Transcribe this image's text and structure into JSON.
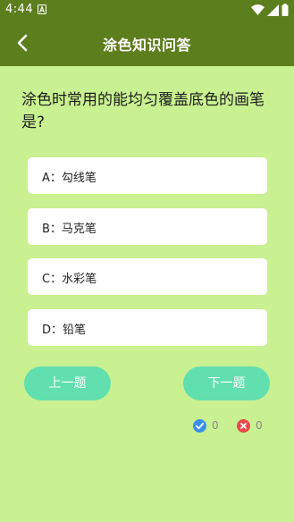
{
  "status_bar": {
    "time": "4:44",
    "notification_icon": "a-notification-icon",
    "wifi_icon": "wifi-icon",
    "signal_icon": "signal-icon",
    "battery_icon": "battery-icon"
  },
  "app_bar": {
    "back_icon": "chevron-left-icon",
    "title": "涂色知识问答"
  },
  "quiz": {
    "question": "涂色时常用的能均匀覆盖底色的画笔是?",
    "options": [
      {
        "text": "A：勾线笔"
      },
      {
        "text": "B：马克笔"
      },
      {
        "text": "C：水彩笔"
      },
      {
        "text": "D：铅笔"
      }
    ],
    "prev_label": "上一题",
    "next_label": "下一题",
    "correct_count": "0",
    "wrong_count": "0"
  },
  "colors": {
    "background": "#c9f191",
    "header": "#5d7e1d",
    "button": "#62dfae",
    "correct": "#3a8fe8",
    "wrong": "#e84a4a"
  }
}
